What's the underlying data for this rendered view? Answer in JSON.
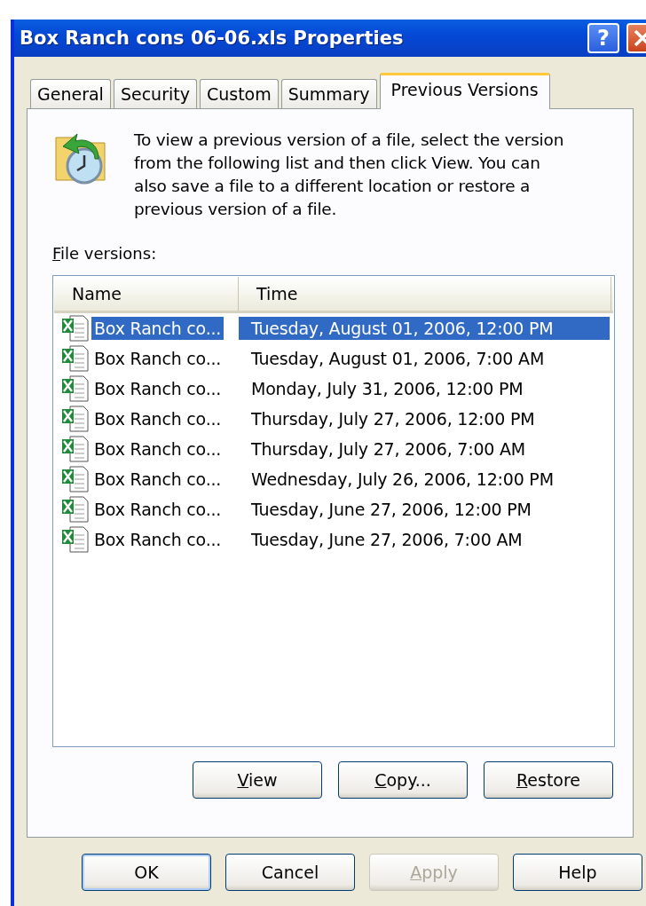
{
  "window": {
    "title": "Box Ranch cons 06-06.xls Properties",
    "help_button": "?"
  },
  "tabs": [
    {
      "label": "General",
      "selected": false
    },
    {
      "label": "Security",
      "selected": false
    },
    {
      "label": "Custom",
      "selected": false
    },
    {
      "label": "Summary",
      "selected": false
    },
    {
      "label": "Previous Versions",
      "selected": true
    }
  ],
  "description": "To view a previous version of a file, select the version from the following list and then click View.  You can also save a file to a different location or restore a previous version of a file.",
  "list_label": {
    "text": "File versions:",
    "accelerator_underlined": true
  },
  "table": {
    "columns": [
      "Name",
      "Time"
    ],
    "rows": [
      {
        "name": "Box Ranch co...",
        "time": "Tuesday, August 01, 2006, 12:00 PM",
        "selected": true
      },
      {
        "name": "Box Ranch co...",
        "time": "Tuesday, August 01, 2006, 7:00 AM",
        "selected": false
      },
      {
        "name": "Box Ranch co...",
        "time": "Monday, July 31, 2006, 12:00 PM",
        "selected": false
      },
      {
        "name": "Box Ranch co...",
        "time": "Thursday, July 27, 2006, 12:00 PM",
        "selected": false
      },
      {
        "name": "Box Ranch co...",
        "time": "Thursday, July 27, 2006, 7:00 AM",
        "selected": false
      },
      {
        "name": "Box Ranch co...",
        "time": "Wednesday, July 26, 2006, 12:00 PM",
        "selected": false
      },
      {
        "name": "Box Ranch co...",
        "time": "Tuesday, June 27, 2006, 12:00 PM",
        "selected": false
      },
      {
        "name": "Box Ranch co...",
        "time": "Tuesday, June 27, 2006, 7:00 AM",
        "selected": false
      }
    ]
  },
  "panel_buttons": [
    {
      "label": "View",
      "accelerator_underlined": true
    },
    {
      "label": "Copy...",
      "accelerator_underlined": true
    },
    {
      "label": "Restore",
      "accelerator_underlined": true
    }
  ],
  "dialog_buttons": [
    {
      "label": "OK",
      "accelerator_underlined": false,
      "disabled": false,
      "default": true
    },
    {
      "label": "Cancel",
      "accelerator_underlined": false,
      "disabled": false,
      "default": false
    },
    {
      "label": "Apply",
      "accelerator_underlined": true,
      "disabled": true,
      "default": false
    },
    {
      "label": "Help",
      "accelerator_underlined": false,
      "disabled": false,
      "default": false
    }
  ]
}
